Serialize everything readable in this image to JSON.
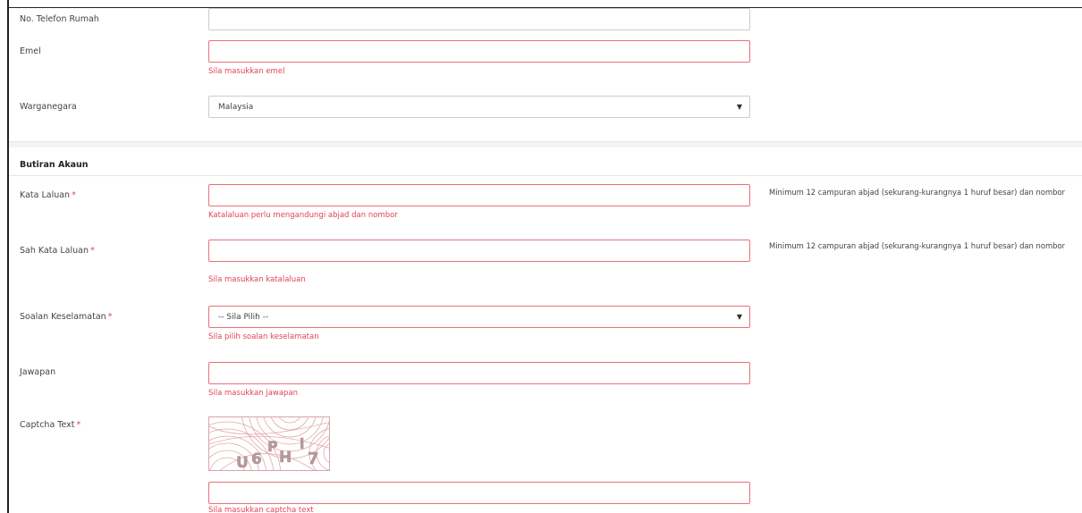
{
  "form": {
    "no_telefon_rumah": {
      "label": "No. Telefon Rumah",
      "value": ""
    },
    "emel": {
      "label": "Emel",
      "value": "",
      "error": "Sila masukkan emel"
    },
    "warganegara": {
      "label": "Warganegara",
      "selected": "Malaysia"
    }
  },
  "akaun": {
    "section_title": "Butiran Akaun",
    "kata_laluan": {
      "label": "Kata Laluan",
      "required_mark": "*",
      "value": "",
      "error": "Katalaluan perlu mengandungi abjad dan nombor",
      "hint": "Minimum 12 campuran abjad (sekurang-kurangnya 1 huruf besar) dan nombor"
    },
    "sah_kata_laluan": {
      "label": "Sah Kata Laluan",
      "required_mark": "*",
      "value": "",
      "error": "Sila masukkan katalaluan",
      "hint": "Minimum 12 campuran abjad (sekurang-kurangnya 1 huruf besar) dan nombor"
    },
    "soalan_keselamatan": {
      "label": "Soalan Keselamatan",
      "required_mark": "*",
      "selected": "-- Sila Pilih --",
      "error": "Sila pilih soalan keselamatan"
    },
    "jawapan": {
      "label": "Jawapan",
      "value": "",
      "error": "Sila masukkan jawapan"
    },
    "captcha": {
      "label": "Captcha Text",
      "required_mark": "*",
      "image_text": "U6PHi7",
      "value": "",
      "error": "Sila masukkan captcha text"
    }
  },
  "icons": {
    "select_caret": "▼"
  },
  "colors": {
    "error": "#e0445a",
    "error_border": "#e8707c",
    "border": "#cccccc"
  }
}
